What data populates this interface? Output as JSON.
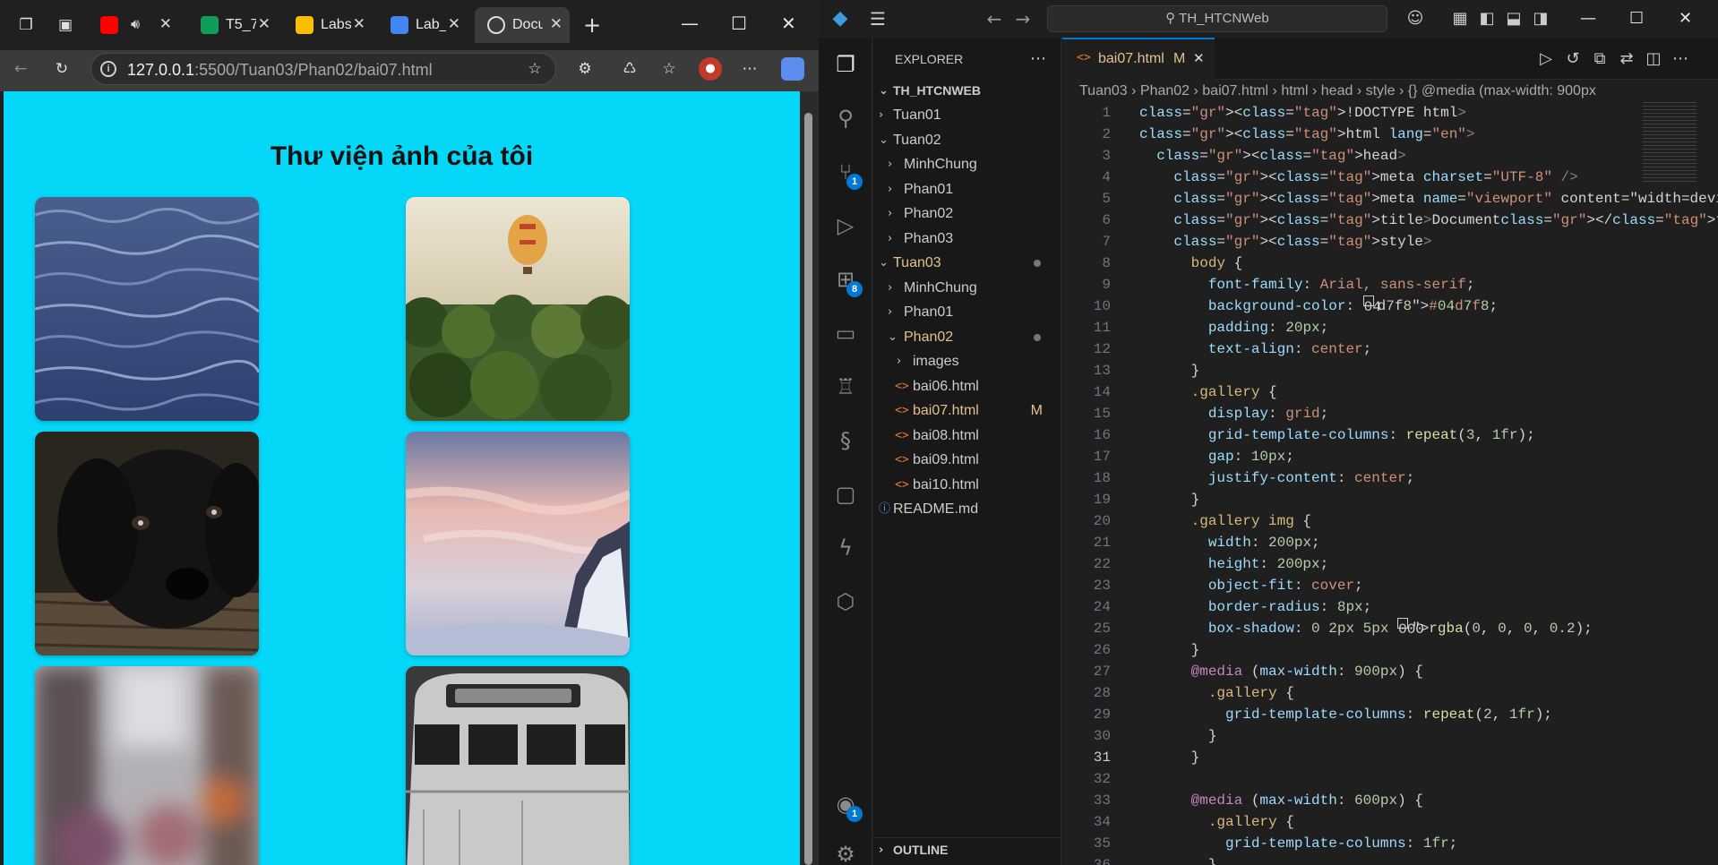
{
  "browser": {
    "tabs": [
      {
        "label": "T5_7",
        "color": "#0f9d58"
      },
      {
        "label": "Labs",
        "color": "#fbbc04"
      },
      {
        "label": "Lab_",
        "color": "#4285f4"
      },
      {
        "label": "Docu",
        "color": "#dddddd"
      }
    ],
    "address": {
      "host": "127.0.0.1",
      "path": ":5500/Tuan03/Phan02/bai07.html"
    },
    "page": {
      "title": "Thư viện ảnh của tôi",
      "background": "#04d7f8",
      "photos": [
        {
          "name": "ocean-waves"
        },
        {
          "name": "hot-air-balloon-palm-trees"
        },
        {
          "name": "black-puppy"
        },
        {
          "name": "snowy-mountain-sunset"
        },
        {
          "name": "blurred-city-street"
        },
        {
          "name": "vintage-camper-van"
        }
      ]
    }
  },
  "vscode": {
    "search": "TH_HTCNWeb",
    "explorer_title": "EXPLORER",
    "workspace": "TH_HTCNWEB",
    "outline": "OUTLINE",
    "badges": {
      "source_control": "1",
      "extensions": "8",
      "account": "1"
    },
    "tree": [
      {
        "label": "Tuan01",
        "type": "folder",
        "open": false,
        "depth": 1
      },
      {
        "label": "Tuan02",
        "type": "folder",
        "open": true,
        "depth": 1
      },
      {
        "label": "MinhChung",
        "type": "folder",
        "open": false,
        "depth": 2
      },
      {
        "label": "Phan01",
        "type": "folder",
        "open": false,
        "depth": 2
      },
      {
        "label": "Phan02",
        "type": "folder",
        "open": false,
        "depth": 2
      },
      {
        "label": "Phan03",
        "type": "folder",
        "open": false,
        "depth": 2
      },
      {
        "label": "Tuan03",
        "type": "folder",
        "open": true,
        "depth": 1,
        "modified": true
      },
      {
        "label": "MinhChung",
        "type": "folder",
        "open": false,
        "depth": 2
      },
      {
        "label": "Phan01",
        "type": "folder",
        "open": false,
        "depth": 2
      },
      {
        "label": "Phan02",
        "type": "folder",
        "open": true,
        "depth": 2,
        "modified": true
      },
      {
        "label": "images",
        "type": "folder",
        "open": false,
        "depth": 3
      },
      {
        "label": "bai06.html",
        "type": "html",
        "depth": 3
      },
      {
        "label": "bai07.html",
        "type": "html",
        "depth": 3,
        "status": "M"
      },
      {
        "label": "bai08.html",
        "type": "html",
        "depth": 3
      },
      {
        "label": "bai09.html",
        "type": "html",
        "depth": 3
      },
      {
        "label": "bai10.html",
        "type": "html",
        "depth": 3
      },
      {
        "label": "README.md",
        "type": "md",
        "depth": 1
      }
    ],
    "editor_tab": {
      "label": "bai07.html",
      "status": "M"
    },
    "breadcrumb": [
      "Tuan03",
      "Phan02",
      "bai07.html",
      "html",
      "head",
      "style",
      "{} @media (max-width: 900px"
    ],
    "code_lines": [
      "<!DOCTYPE html>",
      "<html lang=\"en\">",
      "  <head>",
      "    <meta charset=\"UTF-8\" />",
      "    <meta name=\"viewport\" content=\"width=device-width, init",
      "    <title>Document</title>",
      "    <style>",
      "      body {",
      "        font-family: Arial, sans-serif;",
      "        background-color: #04d7f8;",
      "        padding: 20px;",
      "        text-align: center;",
      "      }",
      "      .gallery {",
      "        display: grid;",
      "        grid-template-columns: repeat(3, 1fr);",
      "        gap: 10px;",
      "        justify-content: center;",
      "      }",
      "      .gallery img {",
      "        width: 200px;",
      "        height: 200px;",
      "        object-fit: cover;",
      "        border-radius: 8px;",
      "        box-shadow: 0 2px 5px rgba(0, 0, 0, 0.2);",
      "      }",
      "      @media (max-width: 900px) {",
      "        .gallery {",
      "          grid-template-columns: repeat(2, 1fr);",
      "        }",
      "      }",
      "",
      "      @media (max-width: 600px) {",
      "        .gallery {",
      "          grid-template-columns: 1fr;",
      "        }"
    ],
    "active_line": 31
  }
}
